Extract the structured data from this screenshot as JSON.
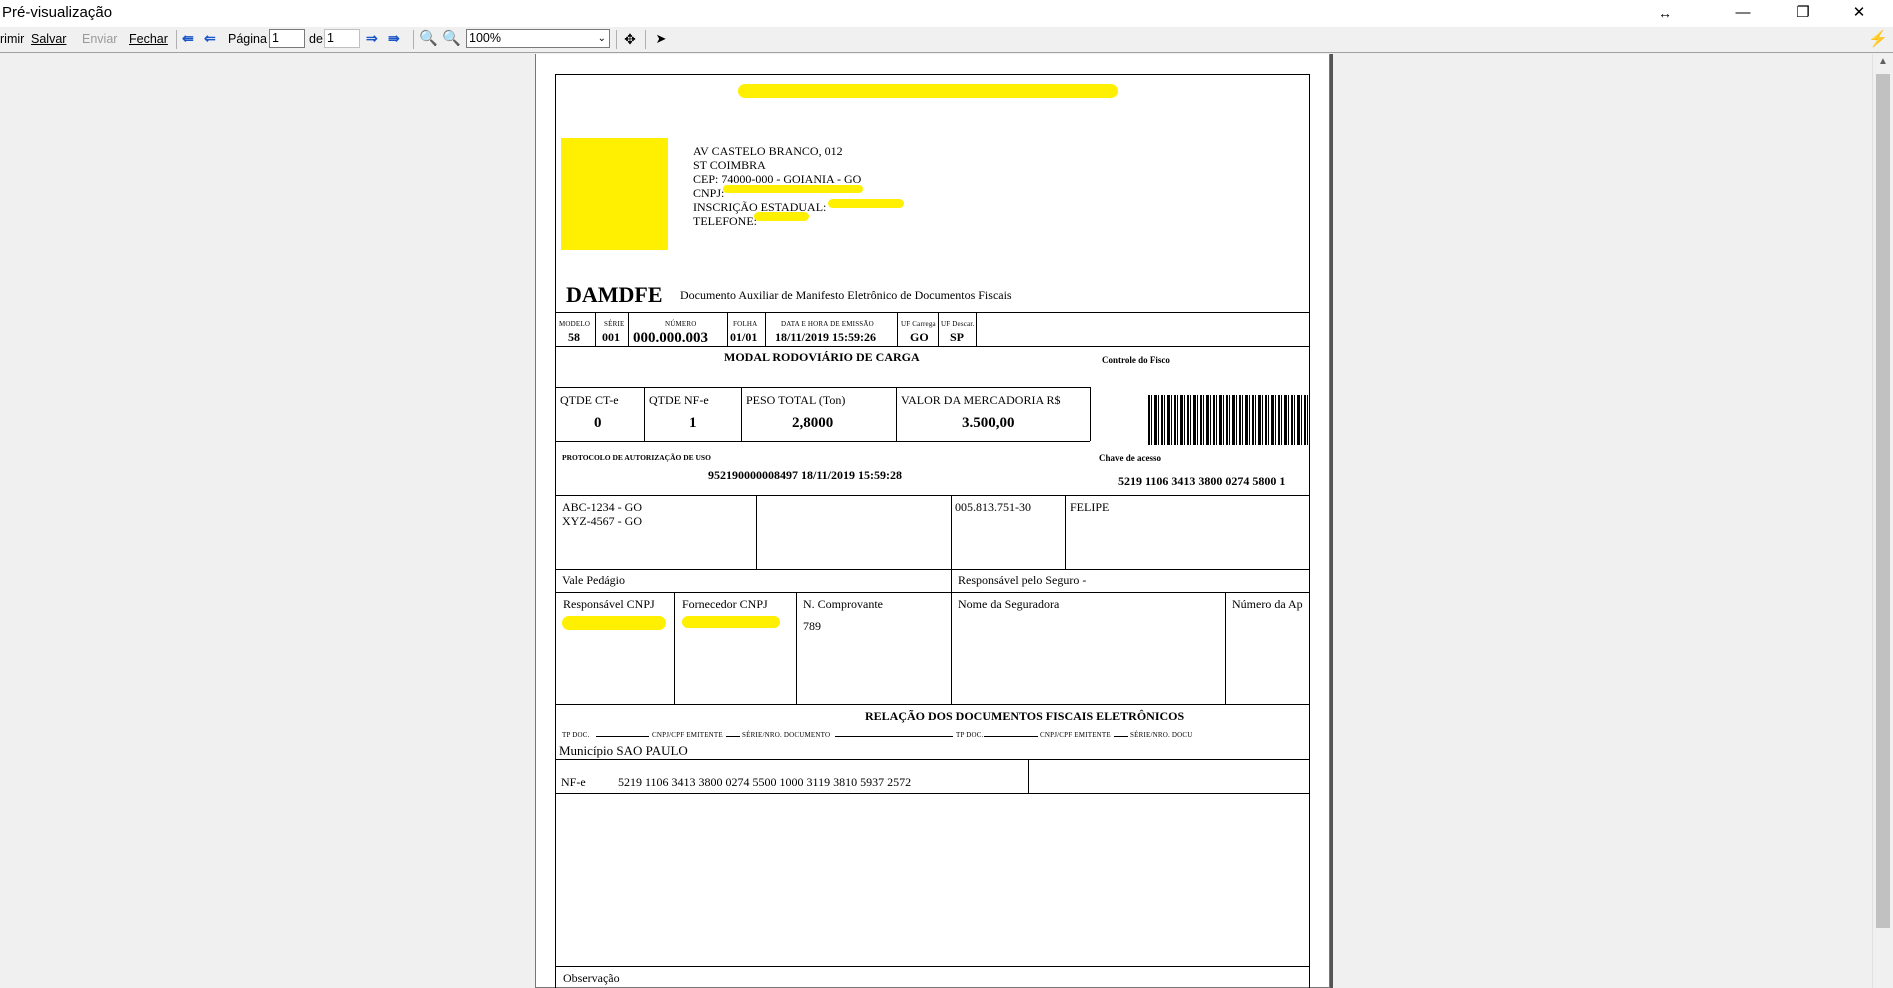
{
  "window": {
    "title": "Pré-visualização",
    "minimize": "—",
    "restore": "❐",
    "close": "✕",
    "resize_hint": "↔"
  },
  "toolbar": {
    "print": "rimir",
    "save": "Salvar",
    "send": "Enviar",
    "close": "Fechar",
    "page_label": "Página",
    "page_value": "1",
    "of_label": "de",
    "of_value": "1",
    "zoom_value": "100%"
  },
  "doc": {
    "address": {
      "line1": "AV CASTELO BRANCO, 012",
      "line2": "ST COIMBRA",
      "line3": "CEP: 74000-000 - GOIANIA - GO",
      "cnpj_label": "CNPJ:",
      "ie_label": "INSCRIÇÃO ESTADUAL:",
      "phone_label": "TELEFONE:"
    },
    "title": "DAMDFE",
    "subtitle": "Documento Auxiliar de Manifesto Eletrônico de Documentos Fiscais",
    "header_fields": {
      "modelo_label": "MODELO",
      "modelo": "58",
      "serie_label": "SÉRIE",
      "serie": "001",
      "numero_label": "NÚMERO",
      "numero": "000.000.003",
      "folha_label": "FOLHA",
      "folha": "01/01",
      "emissao_label": "DATA E HORA DE EMISSÃO",
      "emissao": "18/11/2019 15:59:26",
      "uf_carrega_label": "UF Carrega",
      "uf_carrega": "GO",
      "uf_descar_label": "UF Descar.",
      "uf_descar": "SP"
    },
    "modal_title": "MODAL RODOVIÁRIO DE CARGA",
    "controle_fisco": "Controle do Fisco",
    "totals": {
      "qtde_cte_label": "QTDE CT-e",
      "qtde_cte": "0",
      "qtde_nfe_label": "QTDE NF-e",
      "qtde_nfe": "1",
      "peso_label": "PESO TOTAL (Ton)",
      "peso": "2,8000",
      "valor_label": "VALOR DA MERCADORIA R$",
      "valor": "3.500,00"
    },
    "protocolo_label": "PROTOCOLO DE AUTORIZAÇÃO DE USO",
    "protocolo": "952190000008497  18/11/2019 15:59:28",
    "chave_label": "Chave de acesso",
    "chave": "5219 1106 3413 3800 0274 5800 1",
    "vehicles": [
      "ABC-1234 - GO",
      "XYZ-4567 - GO"
    ],
    "driver_cpf": "005.813.751-30",
    "driver_name": "FELIPE",
    "vale_pedagio": "Vale Pedágio",
    "resp_seguro": "Responsável pelo Seguro -",
    "resp_cnpj_label": "Responsável CNPJ",
    "fornecedor_cnpj_label": "Fornecedor CNPJ",
    "n_comprovante_label": "N. Comprovante",
    "n_comprovante": "789",
    "seguradora_label": "Nome da Seguradora",
    "numero_ap_label": "Número da Ap",
    "relacao_title": "RELAÇÃO DOS DOCUMENTOS FISCAIS ELETRÔNICOS",
    "cols": {
      "tp_doc": "TP DOC.",
      "cnpj_emitente": "CNPJ/CPF EMITENTE",
      "serie_nro": "SÉRIE/NRO. DOCUMENTO",
      "tp_doc2": "TP DOC.",
      "cnpj_emitente2": "CNPJ/CPF EMITENTE",
      "serie_nro2": "SÉRIE/NRO. DOCU"
    },
    "municipio": "Município SAO PAULO",
    "nfe_type": "NF-e",
    "nfe_key": "5219 1106 3413 3800 0274 5500 1000 3119 3810 5937 2572",
    "observacao": "Observação"
  },
  "colors": {
    "highlight": "#ffef00",
    "nav_arrow": "#1a56c8"
  }
}
